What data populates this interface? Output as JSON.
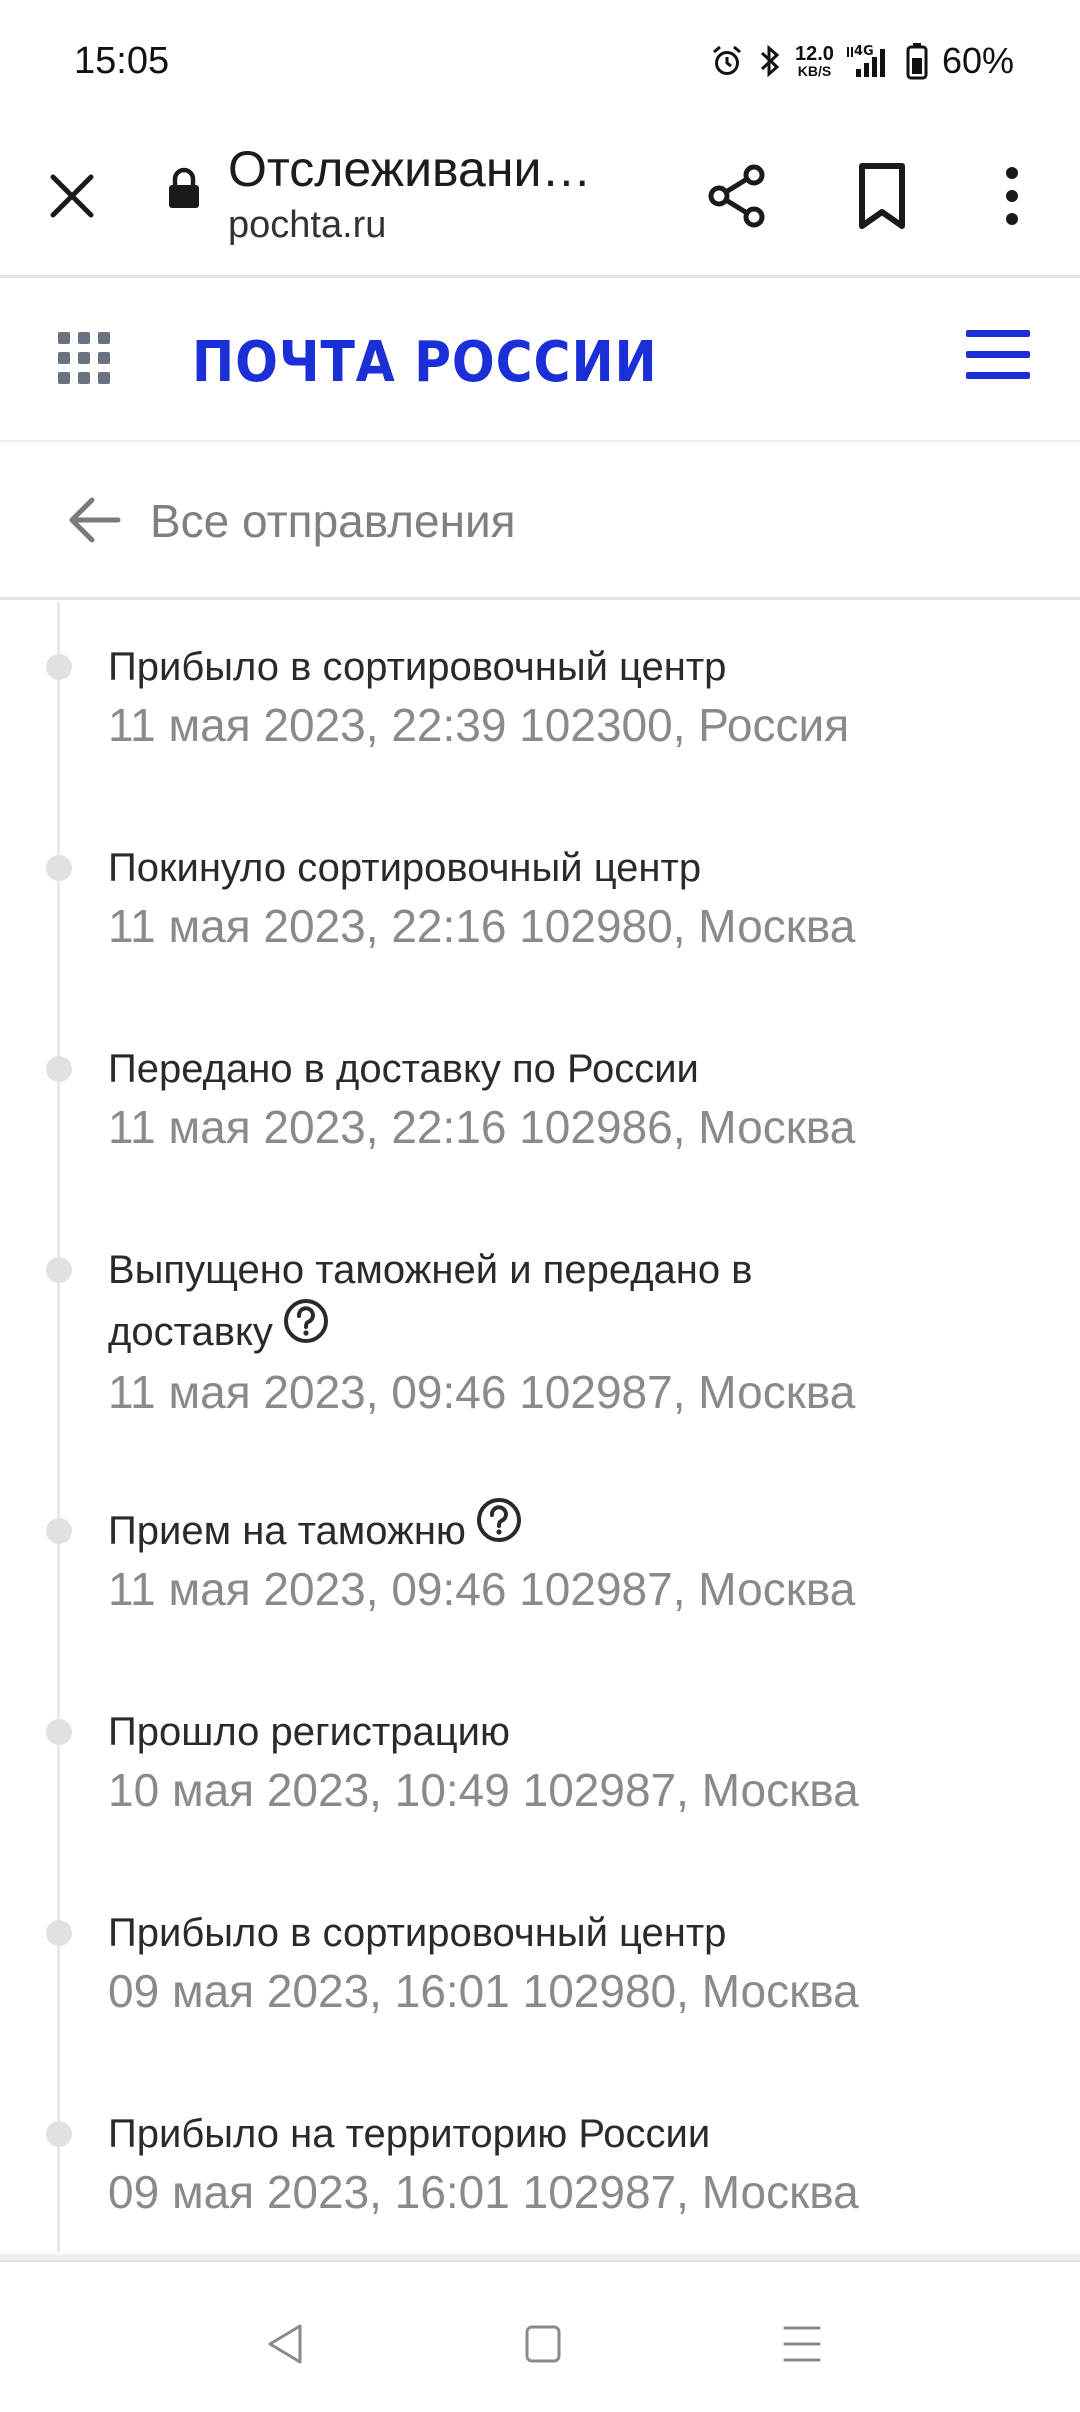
{
  "status_bar": {
    "time": "15:05",
    "net_speed_value": "12.0",
    "net_speed_unit": "KB/S",
    "network_type": "4G",
    "battery": "60%"
  },
  "browser": {
    "title": "Отслеживани…",
    "url": "pochta.ru"
  },
  "site": {
    "brand": "ПОЧТА РОССИИ",
    "brand_color": "#1a2fd6"
  },
  "back_link": {
    "label": "Все отправления"
  },
  "events": [
    {
      "title": "Прибыло в сортировочный центр",
      "meta": "11 мая 2023, 22:39 102300, Россия",
      "help": false
    },
    {
      "title": "Покинуло сортировочный центр",
      "meta": "11 мая 2023, 22:16 102980, Москва",
      "help": false
    },
    {
      "title": "Передано в доставку по России",
      "meta": "11 мая 2023, 22:16 102986, Москва",
      "help": false
    },
    {
      "title_line1": "Выпущено таможней и передано в",
      "title_line2": "доставку",
      "meta": "11 мая 2023, 09:46 102987, Москва",
      "help": true
    },
    {
      "title": "Прием на таможню",
      "meta": "11 мая 2023, 09:46 102987, Москва",
      "help": true
    },
    {
      "title": "Прошло регистрацию",
      "meta": "10 мая 2023, 10:49 102987, Москва",
      "help": false
    },
    {
      "title": "Прибыло в сортировочный центр",
      "meta": "09 мая 2023, 16:01 102980, Москва",
      "help": false
    },
    {
      "title": "Прибыло на территорию России",
      "meta": "09 мая 2023, 16:01 102987, Москва",
      "help": false
    }
  ],
  "icons": {
    "close": "close-icon",
    "lock": "lock-icon",
    "share": "share-icon",
    "bookmark": "bookmark-icon",
    "more": "more-vert-icon",
    "apps": "apps-grid-icon",
    "menu": "hamburger-icon",
    "back": "arrow-left-icon",
    "help": "question-circle-icon"
  }
}
